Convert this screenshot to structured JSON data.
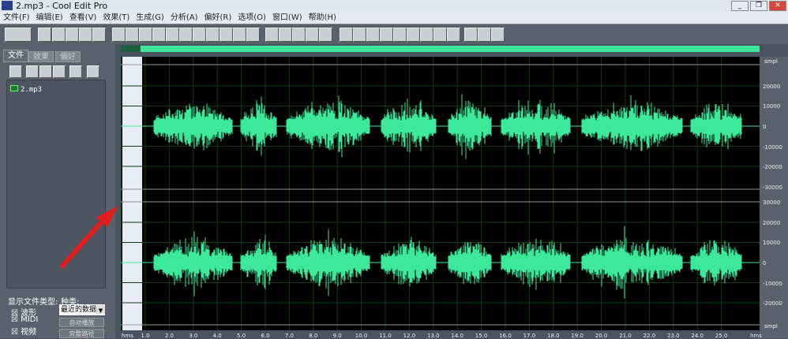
{
  "window": {
    "title": "2.mp3 - Cool Edit Pro",
    "min": "_",
    "max": "❐",
    "close": "✕"
  },
  "menu": [
    "文件(F)",
    "编辑(E)",
    "查看(V)",
    "效果(T)",
    "生成(G)",
    "分析(A)",
    "偏好(R)",
    "选项(O)",
    "窗口(W)",
    "帮助(H)"
  ],
  "left": {
    "tabs": [
      "文件",
      "效果",
      "偏好"
    ],
    "files": [
      "2.mp3"
    ],
    "show_types_label": "显示文件类型:",
    "types": [
      "波形",
      "MIDI",
      "视频"
    ],
    "kind_label": "种类:",
    "kind_value": "最近的数据",
    "buttons": [
      "自动播放",
      "完整路径"
    ]
  },
  "ruler": {
    "unit_top": "smpl",
    "unit_bottom": "smpl",
    "time_unit": "hms",
    "top": [
      "20000",
      "10000",
      "0",
      "-10000",
      "-20000",
      "-30000"
    ],
    "bottom": [
      "30000",
      "20000",
      "10000",
      "0",
      "-10000",
      "-20000"
    ],
    "time": [
      "1.0",
      "2.0",
      "3.0",
      "4.0",
      "5.0",
      "6.0",
      "7.0",
      "8.0",
      "9.0",
      "10.0",
      "11.0",
      "12.0",
      "13.0",
      "14.0",
      "15.0",
      "16.0",
      "17.0",
      "18.0",
      "19.0",
      "20.0",
      "21.0",
      "22.0",
      "23.0",
      "24.0",
      "25.0"
    ]
  },
  "colors": {
    "wave": "#3ee89a",
    "bg": "#000000",
    "grid": "#0f3a12"
  }
}
